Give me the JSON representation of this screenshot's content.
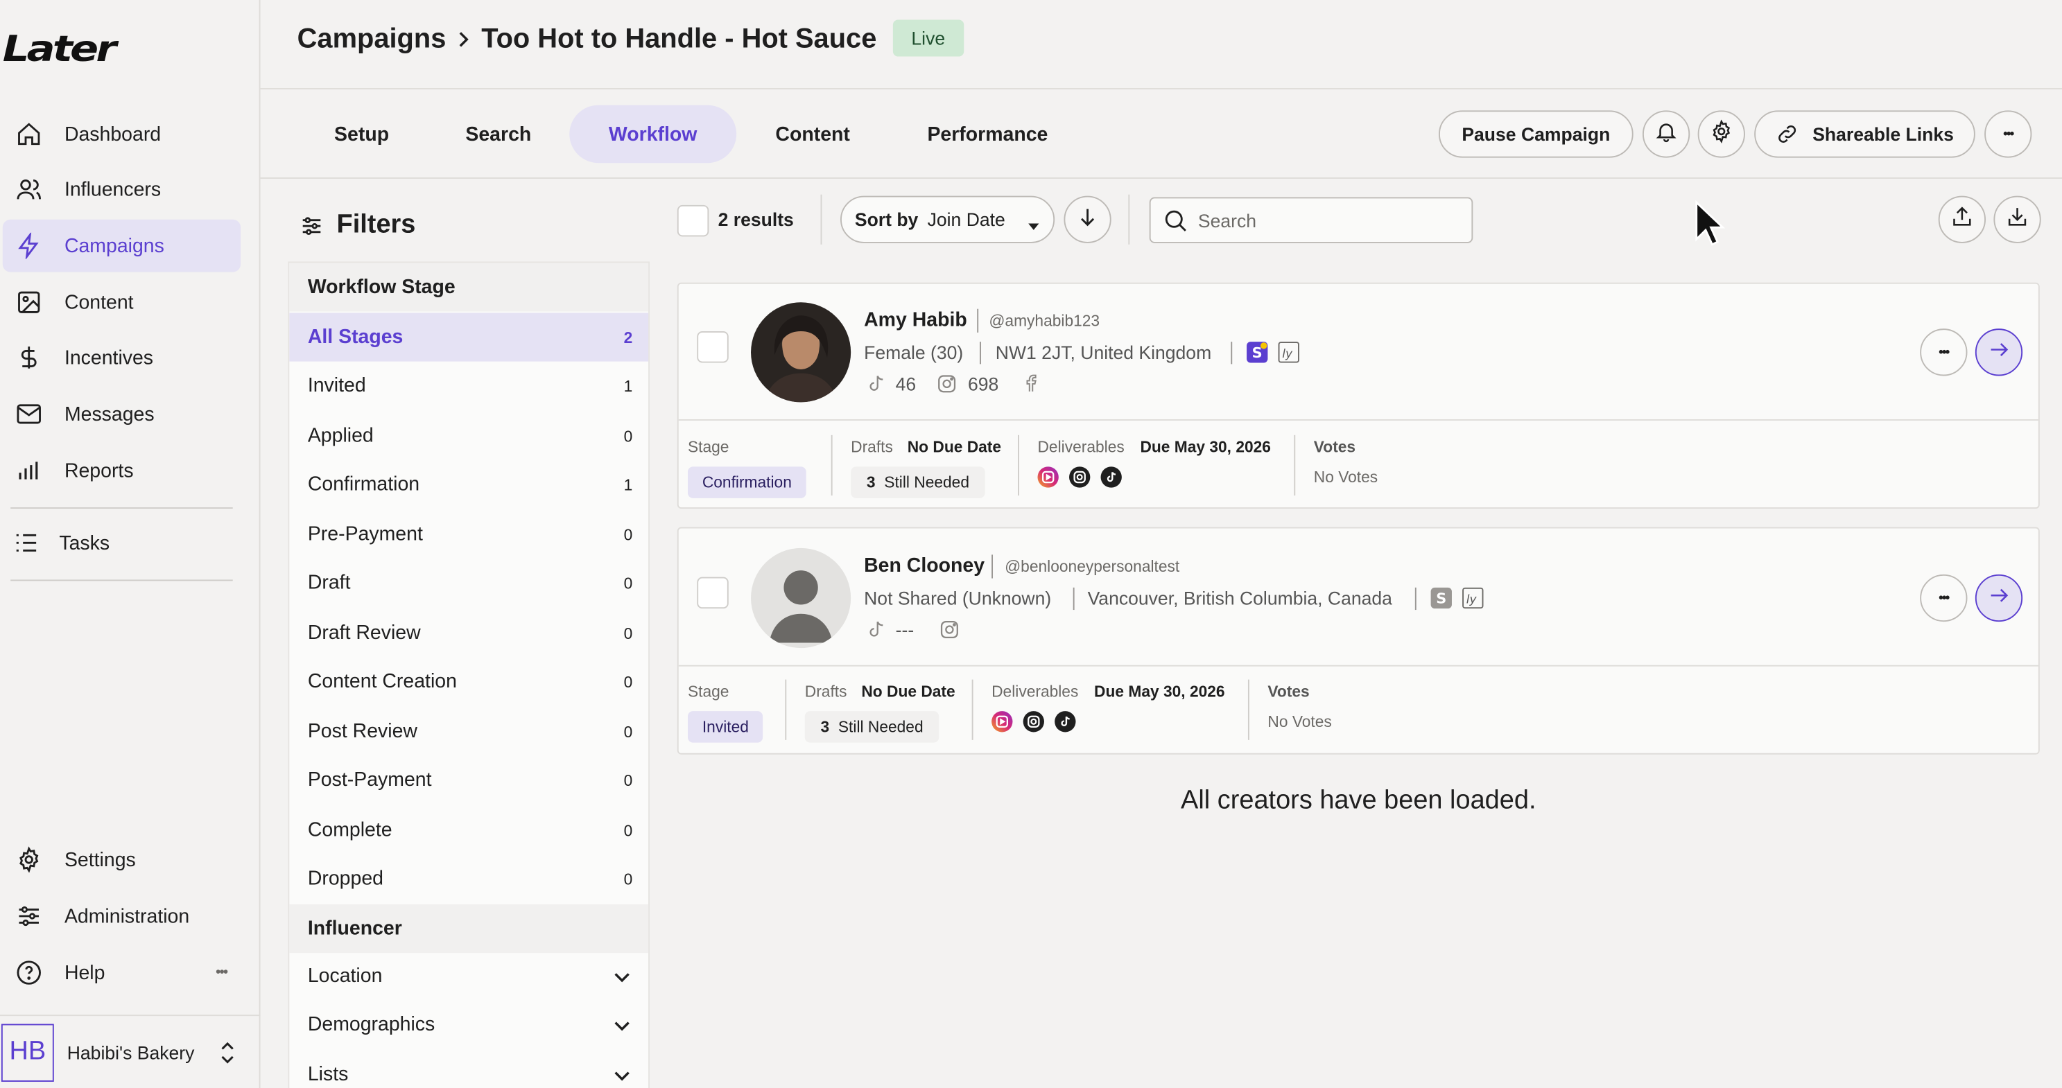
{
  "brand": {
    "logo_text": "Later",
    "accent": "#5b3fd0",
    "accent_bg": "#e5e2f4"
  },
  "sidebar": {
    "items": [
      {
        "label": "Dashboard",
        "icon": "home-icon"
      },
      {
        "label": "Influencers",
        "icon": "users-icon"
      },
      {
        "label": "Campaigns",
        "icon": "bolt-icon",
        "active": true
      },
      {
        "label": "Content",
        "icon": "image-icon"
      },
      {
        "label": "Incentives",
        "icon": "dollar-icon"
      },
      {
        "label": "Messages",
        "icon": "mail-icon"
      },
      {
        "label": "Reports",
        "icon": "bar-chart-icon"
      }
    ],
    "tasks_label": "Tasks",
    "bottom_items": [
      {
        "label": "Settings",
        "icon": "gear-icon"
      },
      {
        "label": "Administration",
        "icon": "sliders-icon"
      },
      {
        "label": "Help",
        "icon": "help-icon"
      }
    ],
    "help_more": "•••",
    "account": {
      "initials": "HB",
      "name": "Habibi's Bakery"
    }
  },
  "header": {
    "breadcrumb_root": "Campaigns",
    "separator": ">",
    "campaign_name": "Too Hot to Handle - Hot Sauce",
    "status_badge": "Live"
  },
  "tabs": [
    {
      "label": "Setup"
    },
    {
      "label": "Search"
    },
    {
      "label": "Workflow",
      "active": true
    },
    {
      "label": "Content"
    },
    {
      "label": "Performance"
    }
  ],
  "actions": {
    "pause": "Pause Campaign",
    "shareable": "Shareable Links",
    "more": "•••"
  },
  "filters": {
    "title": "Filters",
    "workflow_stage_header": "Workflow Stage",
    "stages": [
      {
        "label": "All Stages",
        "count": "2",
        "active": true
      },
      {
        "label": "Invited",
        "count": "1"
      },
      {
        "label": "Applied",
        "count": "0"
      },
      {
        "label": "Confirmation",
        "count": "1"
      },
      {
        "label": "Pre-Payment",
        "count": "0"
      },
      {
        "label": "Draft",
        "count": "0"
      },
      {
        "label": "Draft Review",
        "count": "0"
      },
      {
        "label": "Content Creation",
        "count": "0"
      },
      {
        "label": "Post Review",
        "count": "0"
      },
      {
        "label": "Post-Payment",
        "count": "0"
      },
      {
        "label": "Complete",
        "count": "0"
      },
      {
        "label": "Dropped",
        "count": "0"
      }
    ],
    "influencer_header": "Influencer",
    "influencer_filters": [
      {
        "label": "Location"
      },
      {
        "label": "Demographics"
      },
      {
        "label": "Lists"
      }
    ]
  },
  "toolbar": {
    "results": "2 results",
    "sort_label": "Sort by",
    "sort_value": "Join Date",
    "search_placeholder": "Search"
  },
  "creators": [
    {
      "name": "Amy Habib",
      "handle": "@amyhabib123",
      "demographic": "Female (30)",
      "location": "NW1 2JT, United Kingdom",
      "tiktok_followers": "46",
      "instagram_followers": "698",
      "stage_label": "Stage",
      "stage": "Confirmation",
      "drafts_label": "Drafts",
      "drafts_due": "No Due Date",
      "still_needed_count": "3",
      "still_needed": "Still Needed",
      "deliverables_label": "Deliverables",
      "deliverables_due": "Due May 30, 2026",
      "votes_label": "Votes",
      "votes": "No Votes"
    },
    {
      "name": "Ben Clooney",
      "handle": "@benlooneypersonaltest",
      "demographic": "Not Shared (Unknown)",
      "location": "Vancouver, British Columbia, Canada",
      "tiktok_followers": "---",
      "instagram_followers": "",
      "stage_label": "Stage",
      "stage": "Invited",
      "drafts_label": "Drafts",
      "drafts_due": "No Due Date",
      "still_needed_count": "3",
      "still_needed": "Still Needed",
      "deliverables_label": "Deliverables",
      "deliverables_due": "Due May 30, 2026",
      "votes_label": "Votes",
      "votes": "No Votes"
    }
  ],
  "loaded_message": "All creators have been loaded."
}
